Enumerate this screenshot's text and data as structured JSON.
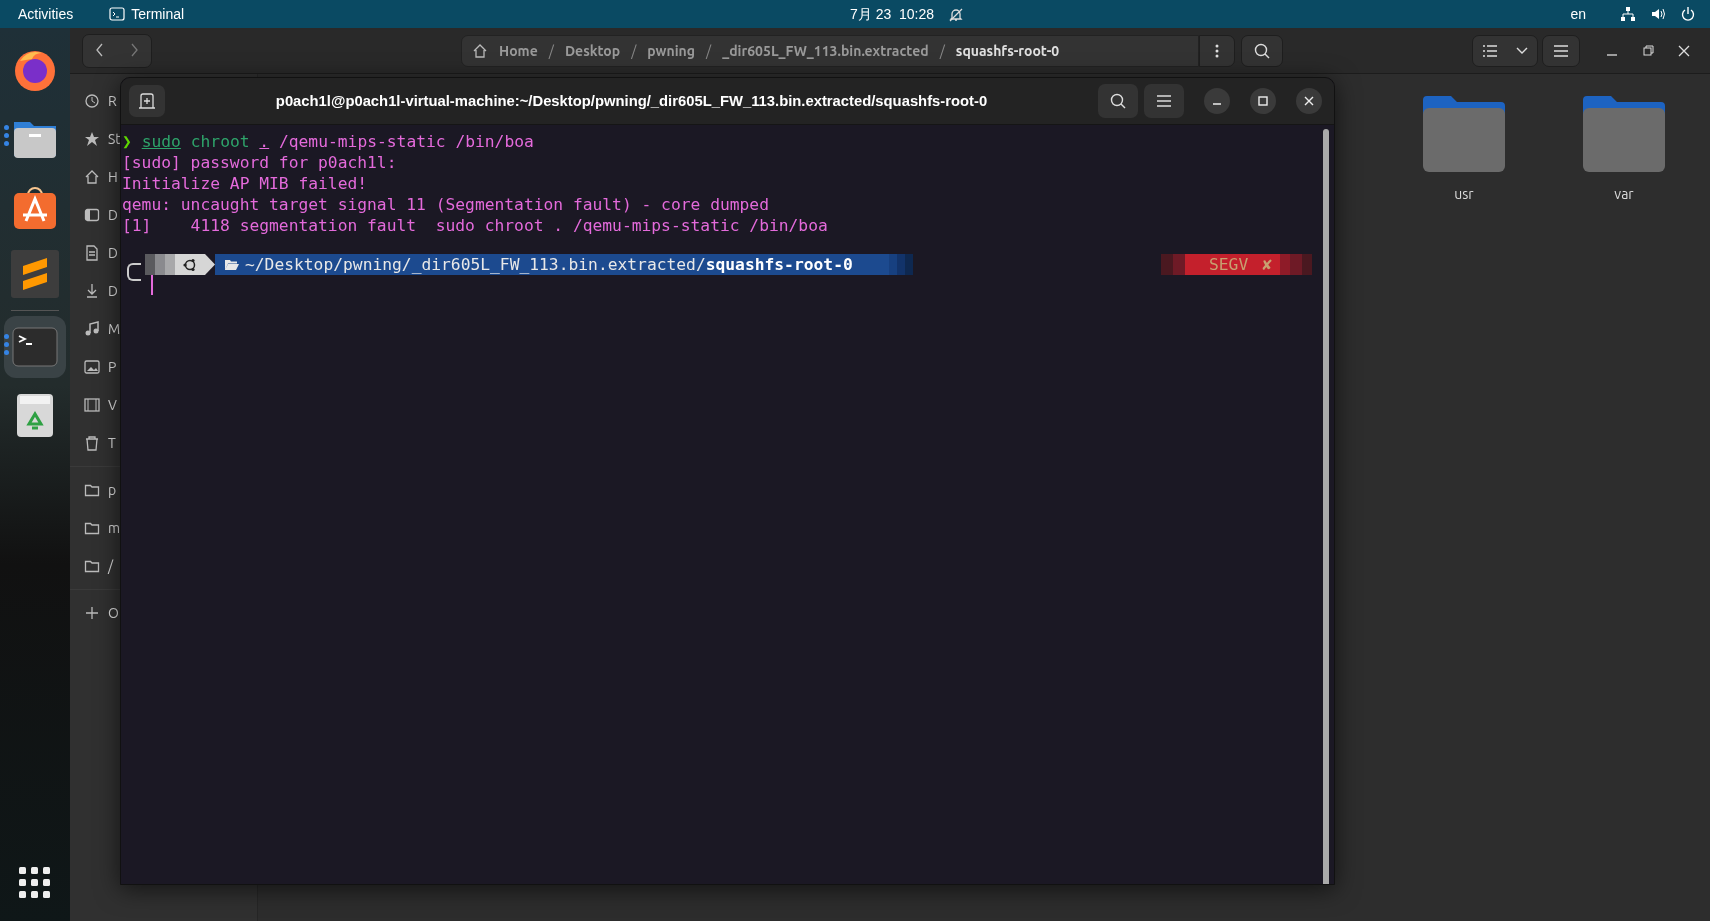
{
  "top_bar": {
    "activities": "Activities",
    "app": "Terminal",
    "clock": "7月 23  10:28",
    "language": "en"
  },
  "dock": {
    "items": [
      {
        "kind": "firefox",
        "running": false,
        "selected": false
      },
      {
        "kind": "files",
        "running": true,
        "selected": false
      },
      {
        "kind": "software",
        "running": false,
        "selected": false
      },
      {
        "kind": "editor",
        "running": false,
        "selected": false
      },
      {
        "kind": "terminal",
        "running": true,
        "selected": true
      },
      {
        "kind": "recycle",
        "running": false,
        "selected": false
      }
    ]
  },
  "files_window": {
    "path": [
      {
        "kind": "home",
        "label": "Home"
      },
      {
        "kind": "separator",
        "label": "/"
      },
      {
        "kind": "crumb",
        "label": "Desktop"
      },
      {
        "kind": "separator",
        "label": "/"
      },
      {
        "kind": "crumb",
        "label": "pwning"
      },
      {
        "kind": "separator",
        "label": "/"
      },
      {
        "kind": "crumb",
        "label": "_dir605L_FW_113.bin.extracted"
      },
      {
        "kind": "separator",
        "label": "/"
      },
      {
        "kind": "crumb",
        "label": "squashfs-root-0"
      }
    ],
    "sidebar": [
      {
        "kind": "recent",
        "label": "R"
      },
      {
        "kind": "starred",
        "label": "St"
      },
      {
        "kind": "home",
        "label": "H"
      },
      {
        "kind": "desktop",
        "label": "D"
      },
      {
        "kind": "documents",
        "label": "D"
      },
      {
        "kind": "downloads",
        "label": "D"
      },
      {
        "kind": "music",
        "label": "M"
      },
      {
        "kind": "pictures",
        "label": "P"
      },
      {
        "kind": "videos",
        "label": "V"
      },
      {
        "kind": "trash",
        "label": "T"
      },
      {
        "kind": "separator"
      },
      {
        "kind": "folder",
        "label": "p"
      },
      {
        "kind": "folder",
        "label": "m"
      },
      {
        "kind": "folder",
        "label": "/"
      },
      {
        "kind": "separator"
      },
      {
        "kind": "add",
        "label": "O"
      }
    ],
    "folders": [
      {
        "name": "usr"
      },
      {
        "name": "var"
      }
    ]
  },
  "terminal": {
    "title": "p0ach1l@p0ach1l-virtual-machine:~/Desktop/pwning/_dir605L_FW_113.bin.extracted/squashfs-root-0",
    "lines": [
      [
        {
          "text": "❯",
          "kind": "arrow"
        },
        {
          "text": "sudo",
          "kind": "command"
        },
        {
          "text": " chroot ",
          "kind": "word"
        },
        {
          "text": ".",
          "kind": "path"
        },
        {
          "text": " /qemu-mips-static /bin/boa",
          "kind": "plain"
        }
      ],
      [
        {
          "text": "[sudo] password for p0ach1l:",
          "kind": "plain"
        }
      ],
      [
        {
          "text": "Initialize AP MIB failed!",
          "kind": "plain"
        }
      ],
      [
        {
          "text": "qemu: uncaught target signal 11 (Segmentation fault) - core dumped",
          "kind": "plain"
        }
      ],
      [
        {
          "text": "[1]    4118 segmentation fault  sudo chroot . /qemu-mips-static /bin/boa",
          "kind": "plain"
        }
      ]
    ],
    "prompt": {
      "path": "~/Desktop/pwning/_dir605L_FW_113.bin.extracted/",
      "dir": "squashfs-root-0",
      "status": "SEGV",
      "status_mark": "✘"
    }
  }
}
